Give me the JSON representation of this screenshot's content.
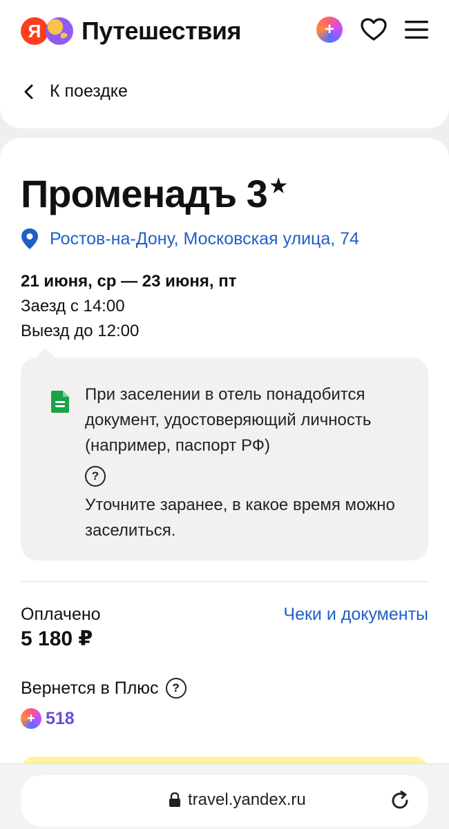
{
  "header": {
    "logo_letter": "Я",
    "brand": "Путешествия",
    "plus_symbol": "+",
    "icons": [
      "plus-icon",
      "heart-icon",
      "menu-icon"
    ]
  },
  "nav": {
    "back_label": "К поездке"
  },
  "hotel": {
    "name": "Променадъ 3",
    "star_symbol": "★",
    "address": "Ростов-на-Дону, Московская улица, 74"
  },
  "stay": {
    "dates": "21 июня, ср — 23 июня, пт",
    "checkin": "Заезд с 14:00",
    "checkout": "Выезд до 12:00"
  },
  "notice": {
    "text": "При заселении в отель понадобится документ, удостоверяющий личность (например, паспорт РФ)",
    "help_symbol": "?",
    "extra": "Уточните заранее, в какое время можно заселиться."
  },
  "payment": {
    "paid_label": "Оплачено",
    "paid_value": "5 180 ₽",
    "receipts_link": "Чеки и документы",
    "cashback_label": "Вернется в Плюс",
    "cashback_value": "518"
  },
  "browser": {
    "url": "travel.yandex.ru"
  },
  "colors": {
    "accent_link": "#1f5fc6",
    "yandex_red": "#fc3f1d",
    "doc_green": "#1aa24a",
    "plus_purple": "#6d4bd8",
    "banner_yellow": "#fff3a3"
  }
}
